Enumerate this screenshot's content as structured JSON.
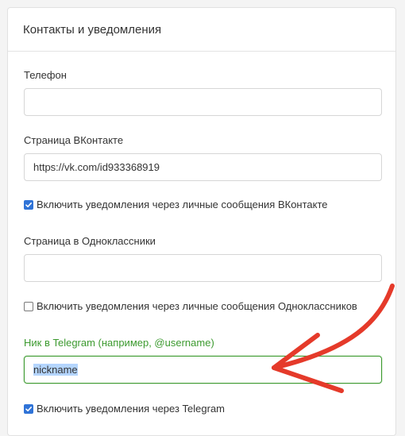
{
  "card": {
    "title": "Контакты и уведомления"
  },
  "phone": {
    "label": "Телефон",
    "value": "",
    "placeholder": ""
  },
  "vk": {
    "label": "Страница ВКонтакте",
    "value": "https://vk.com/id933368919",
    "notify_label": "Включить уведомления через личные сообщения ВКонтакте",
    "notify_checked": true
  },
  "ok": {
    "label": "Страница в Одноклассники",
    "value": "",
    "notify_label": "Включить уведомления через личные сообщения Одноклассников",
    "notify_checked": false
  },
  "telegram": {
    "label": "Ник в Telegram (например, @username)",
    "value": "nickname",
    "notify_label": "Включить уведомления через Telegram",
    "notify_checked": true
  },
  "colors": {
    "accent": "#2f73d7",
    "success": "#3c9a2f",
    "annotation_arrow": "#e53a2a"
  },
  "icons": {
    "checkbox_checked": "checkmark-icon",
    "annotation": "red-arrow-annotation"
  }
}
